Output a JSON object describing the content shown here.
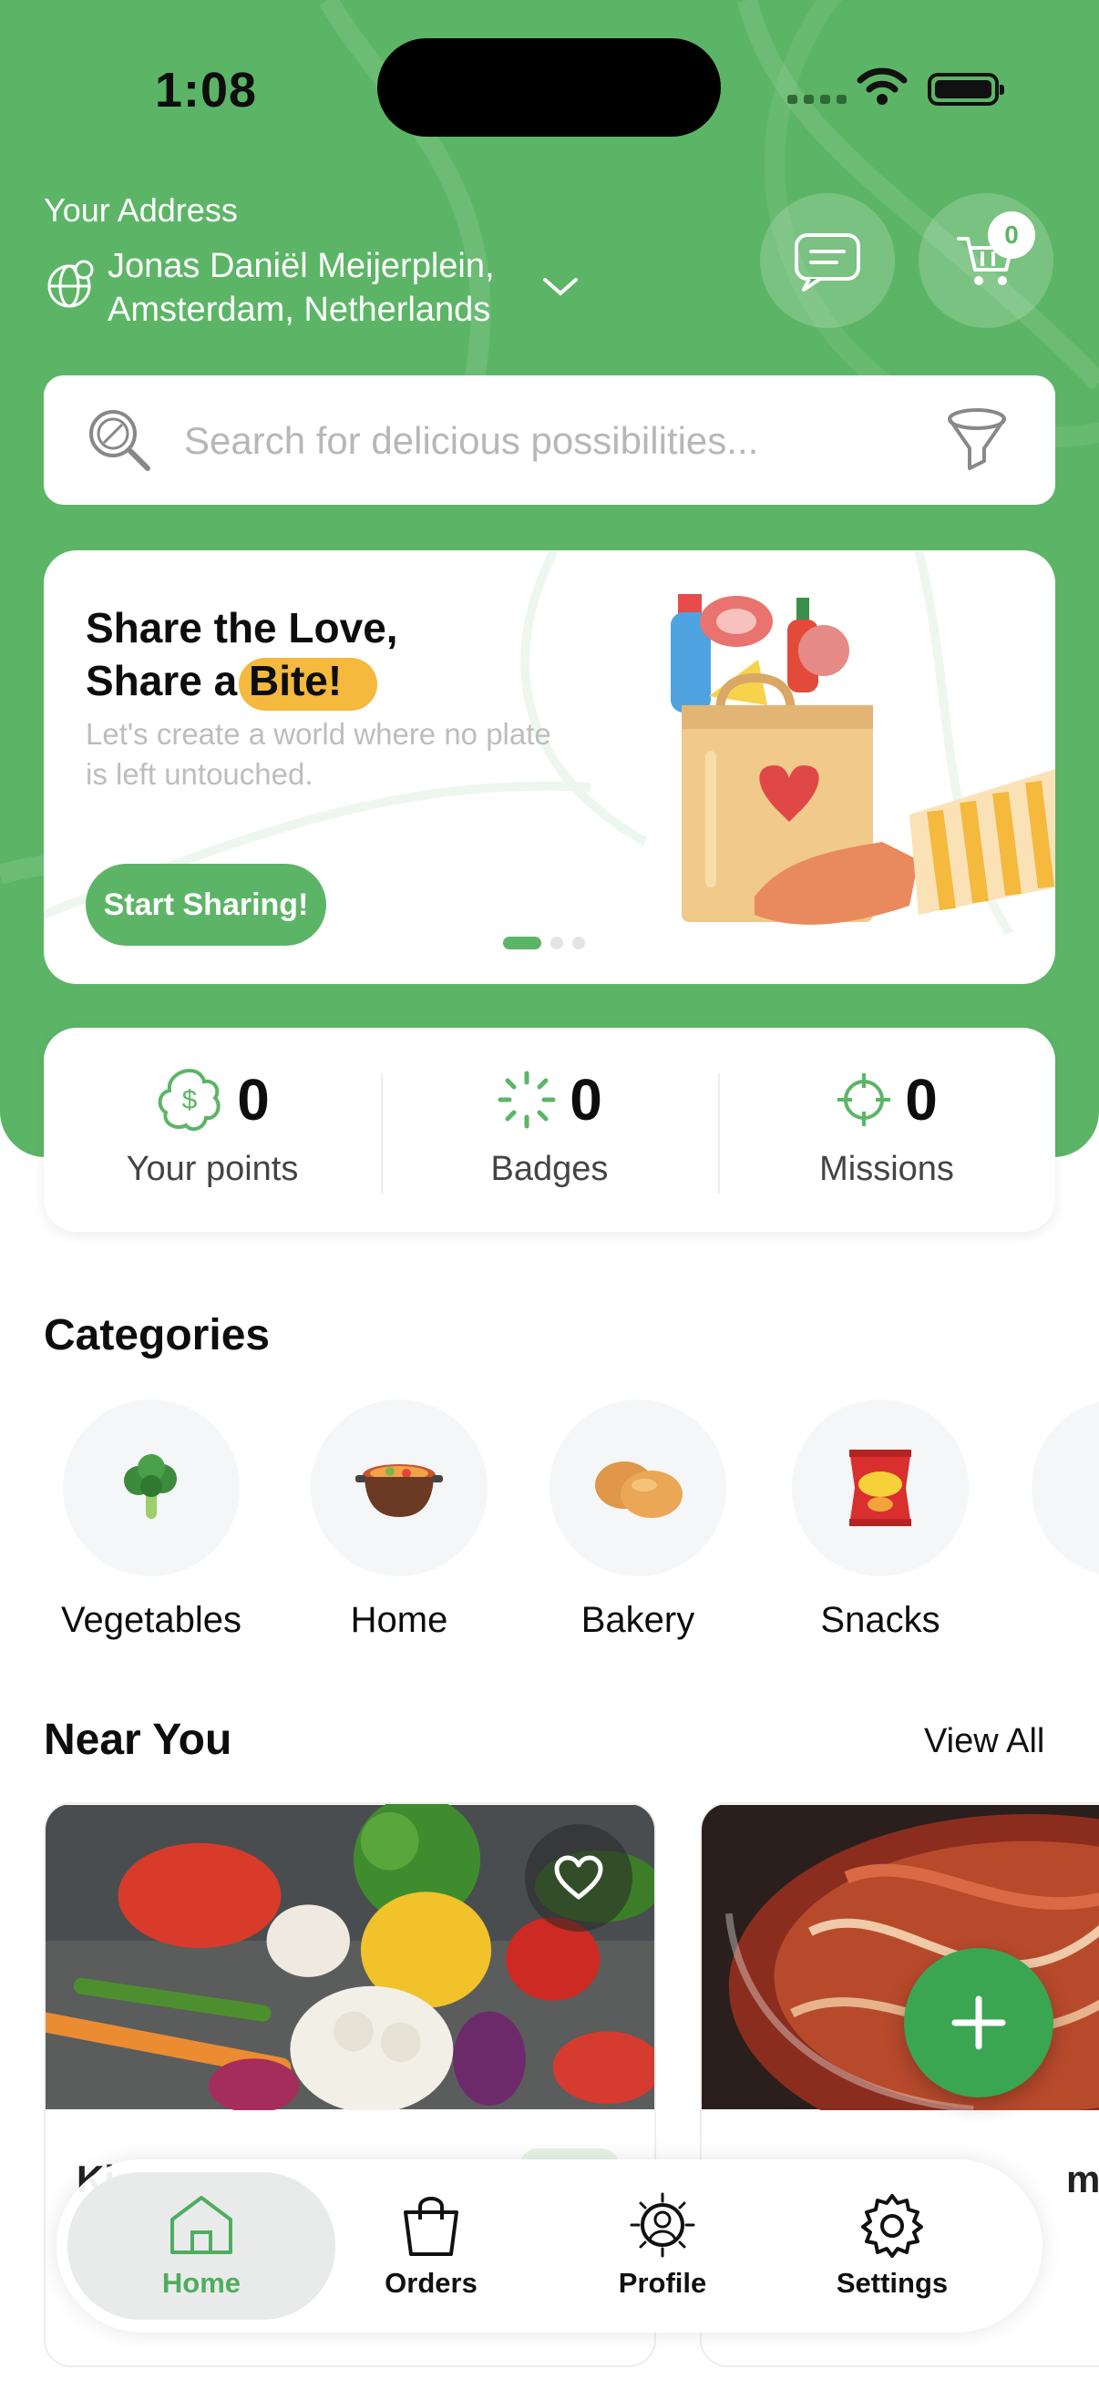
{
  "status_bar": {
    "time": "1:08"
  },
  "header": {
    "address_label": "Your Address",
    "address_line1": "Jonas Daniël Meijerplein,",
    "address_line2": "Amsterdam, Netherlands",
    "cart_count": "0"
  },
  "search": {
    "placeholder": "Search for delicious possibilities..."
  },
  "banner": {
    "title_line1": "Share the Love,",
    "title_line2": "Share a Bite!",
    "subtitle": "Let's create a world where no plate is left untouched.",
    "button": "Start Sharing!",
    "slides": 3,
    "active_slide": 1
  },
  "stats": [
    {
      "value": "0",
      "label": "Your points",
      "icon": "points-icon"
    },
    {
      "value": "0",
      "label": "Badges",
      "icon": "badge-icon"
    },
    {
      "value": "0",
      "label": "Missions",
      "icon": "target-icon"
    }
  ],
  "categories": {
    "title": "Categories",
    "items": [
      {
        "label": "Vegetables",
        "icon": "broccoli-icon"
      },
      {
        "label": "Home",
        "icon": "pot-icon"
      },
      {
        "label": "Bakery",
        "icon": "bread-icon"
      },
      {
        "label": "Snacks",
        "icon": "chips-icon"
      }
    ]
  },
  "near_you": {
    "title": "Near You",
    "view_all": "View All",
    "cards": [
      {
        "title": "Ki",
        "image": "vegetables-photo"
      },
      {
        "title": "made",
        "image": "kimchi-photo"
      }
    ]
  },
  "tabbar": {
    "items": [
      {
        "label": "Home",
        "icon": "home-icon",
        "active": true
      },
      {
        "label": "Orders",
        "icon": "bag-icon",
        "active": false
      },
      {
        "label": "Profile",
        "icon": "profile-icon",
        "active": false
      },
      {
        "label": "Settings",
        "icon": "gear-icon",
        "active": false
      }
    ]
  },
  "colors": {
    "brand": "#5cb566",
    "accent": "#f4b93d",
    "fab": "#3aa652"
  }
}
